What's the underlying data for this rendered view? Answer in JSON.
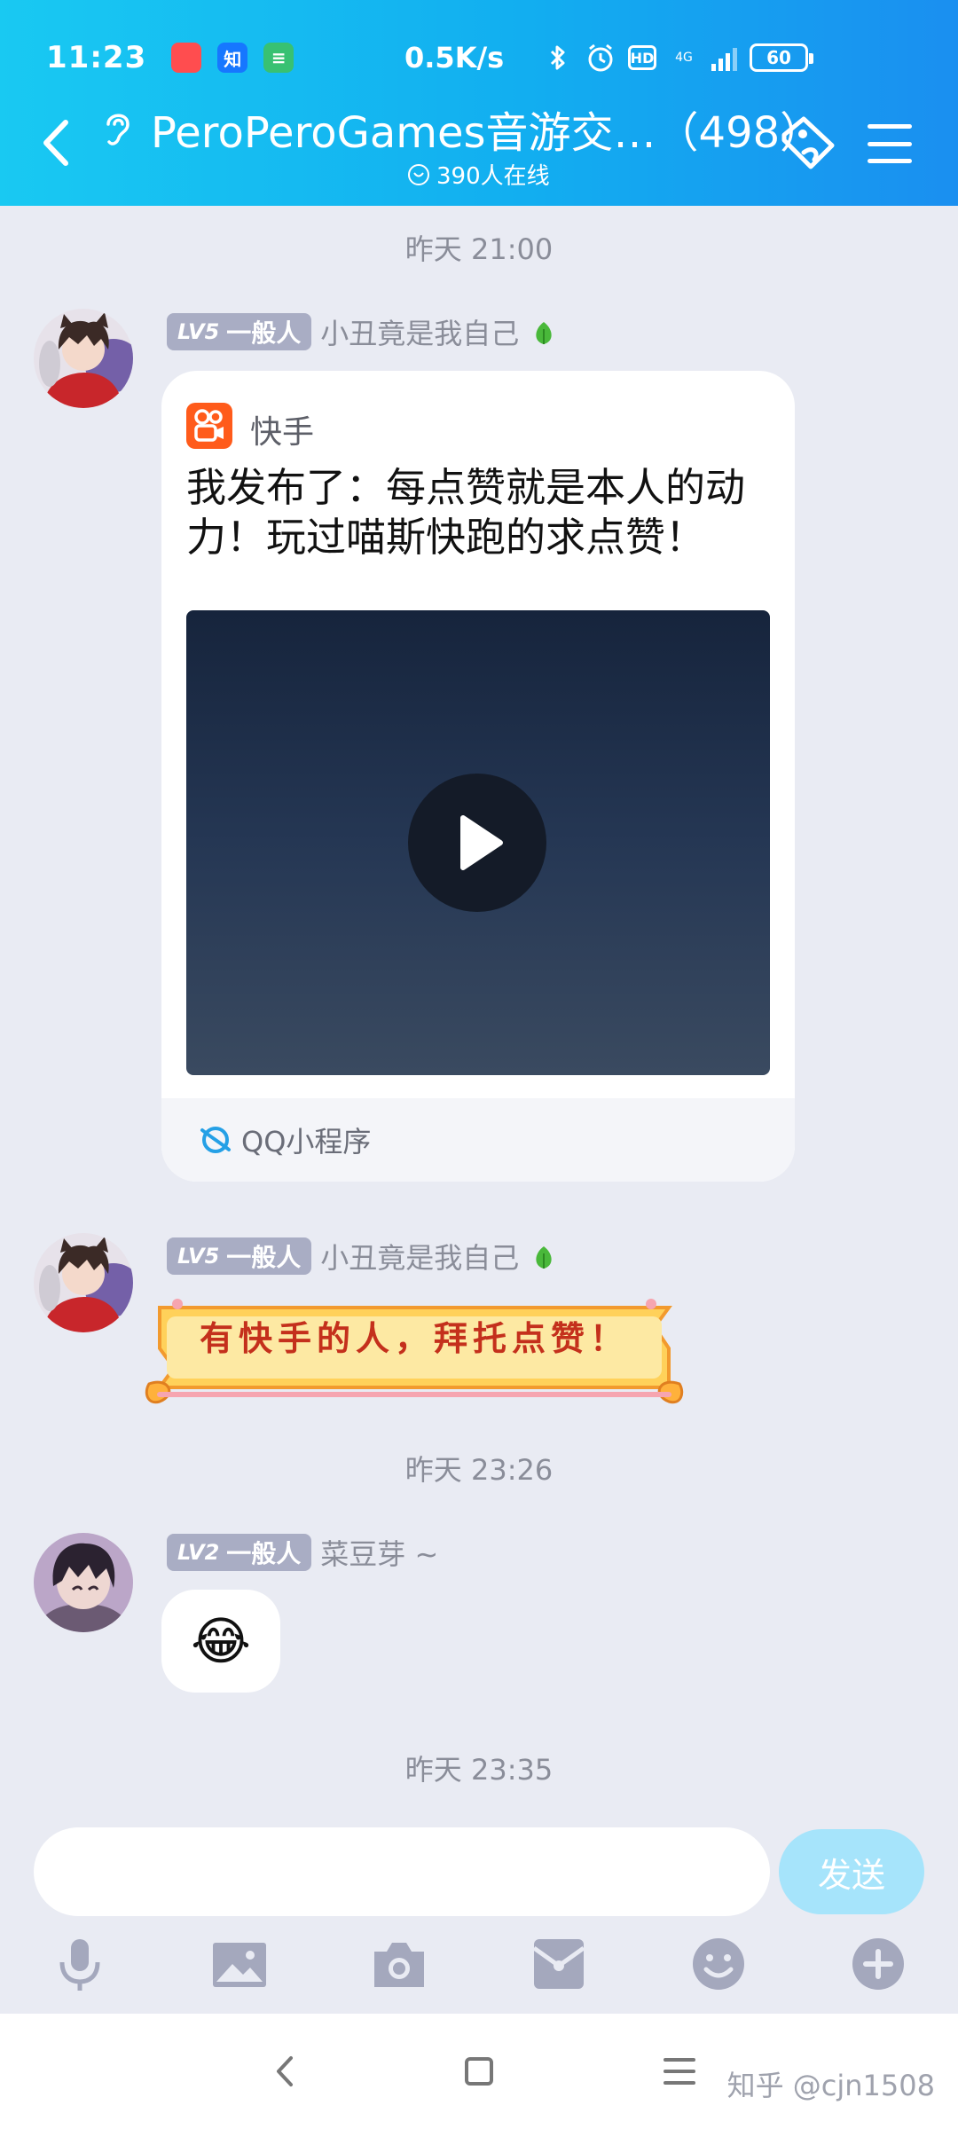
{
  "status_bar": {
    "time": "11:23",
    "app_icons": [
      {
        "name": "pinduoduo-icon",
        "glyph": "",
        "color": "#ff4d4f"
      },
      {
        "name": "zhihu-icon",
        "glyph": "知",
        "color": "#1677ff"
      },
      {
        "name": "notes-icon",
        "glyph": "≡",
        "color": "#38c172"
      }
    ],
    "net_speed": "0.5K/s",
    "network": "4G",
    "hd": "HD",
    "battery": "60"
  },
  "header": {
    "title": "PeroPeroGames音游交…（498）",
    "online": "390人在线"
  },
  "messages": {
    "sep1": "昨天 21:00",
    "msg1": {
      "level_tag": "LV5",
      "level_title": "一般人",
      "nick": "小丑竟是我自己",
      "card": {
        "app_name": "快手",
        "text": "我发布了：每点赞就是本人的动力！玩过喵斯快跑的求点赞！",
        "source": "QQ小程序"
      }
    },
    "msg2": {
      "level_tag": "LV5",
      "level_title": "一般人",
      "nick": "小丑竟是我自己",
      "banner_text": "有快手的人，拜托点赞！"
    },
    "sep2": "昨天 23:26",
    "msg3": {
      "level_tag": "LV2",
      "level_title": "一般人",
      "nick": "菜豆芽 ~",
      "emoji": "😂"
    },
    "sep3": "昨天 23:35"
  },
  "composer": {
    "send_label": "发送",
    "input_value": ""
  },
  "watermark": "知乎 @cjn1508",
  "colors": {
    "header_start": "#19c9f2",
    "header_end": "#1a8ff0",
    "send_disabled": "#a6e4fb",
    "level_tag": "#a9adc4",
    "kuaishou": "#ff5b1b"
  }
}
